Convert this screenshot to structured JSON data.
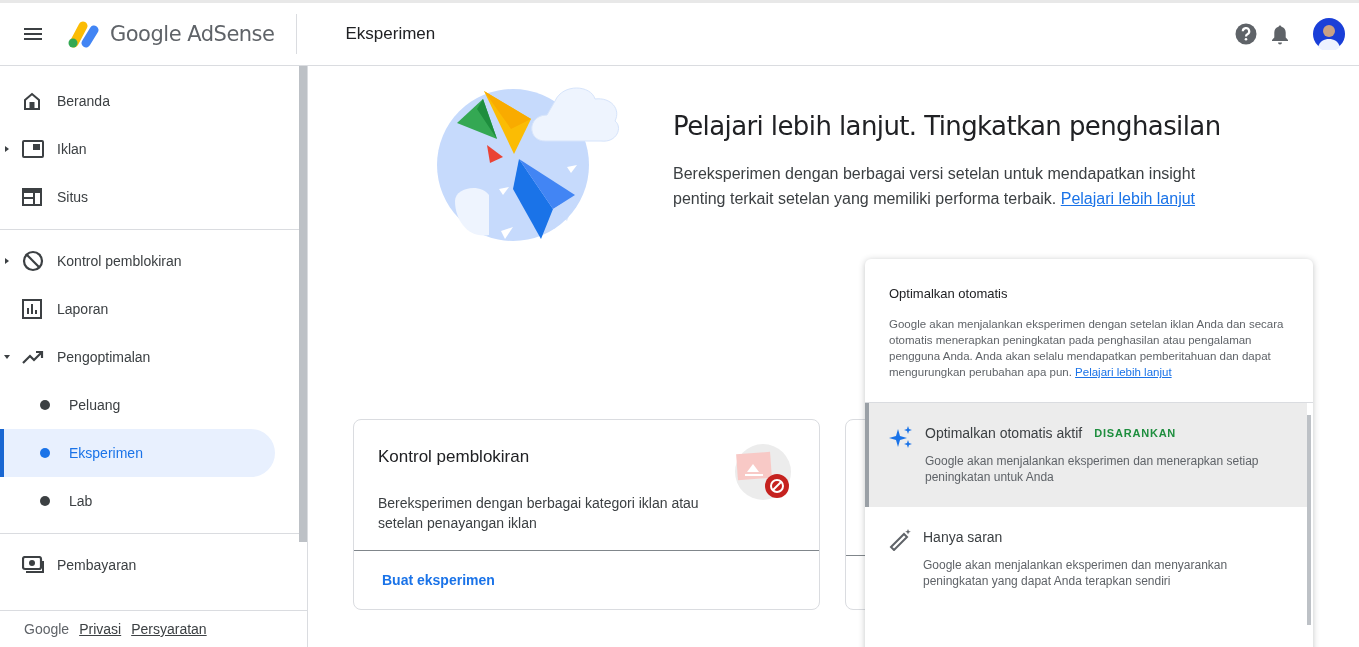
{
  "header": {
    "product": "Google AdSense",
    "page_title": "Eksperimen"
  },
  "sidebar": {
    "sections": [
      [
        {
          "label": "Beranda"
        },
        {
          "label": "Iklan",
          "expanded": false
        },
        {
          "label": "Situs"
        }
      ],
      [
        {
          "label": "Kontrol pemblokiran",
          "expanded": false
        },
        {
          "label": "Laporan"
        },
        {
          "label": "Pengoptimalan",
          "expanded": true,
          "children": [
            {
              "label": "Peluang",
              "selected": false
            },
            {
              "label": "Eksperimen",
              "selected": true
            },
            {
              "label": "Lab",
              "selected": false
            }
          ]
        }
      ],
      [
        {
          "label": "Pembayaran"
        }
      ]
    ],
    "footer": {
      "brand": "Google",
      "links": [
        "Privasi",
        "Persyaratan"
      ]
    }
  },
  "hero": {
    "title": "Pelajari lebih lanjut. Tingkatkan penghasilan",
    "text": "Bereksperimen dengan berbagai versi setelan untuk mendapatkan insight penting terkait setelan yang memiliki performa terbaik.",
    "link": "Pelajari lebih lanjut"
  },
  "cards": [
    {
      "title": "Kontrol pemblokiran",
      "text": "Bereksperimen dengan berbagai kategori iklan atau setelan penayangan iklan",
      "action": "Buat eksperimen"
    }
  ],
  "popup": {
    "title": "Optimalkan otomatis",
    "text": "Google akan menjalankan eksperimen dengan setelan iklan Anda dan secara otomatis menerapkan peningkatan pada penghasilan atau pengalaman pengguna Anda. Anda akan selalu mendapatkan pemberitahuan dan dapat mengurungkan perubahan apa pun.",
    "link": "Pelajari lebih lanjut",
    "options": [
      {
        "title": "Optimalkan otomatis aktif",
        "badge": "DISARANKAN",
        "text": "Google akan menjalankan eksperimen dan menerapkan setiap peningkatan untuk Anda",
        "selected": true
      },
      {
        "title": "Hanya saran",
        "text": "Google akan menjalankan eksperimen dan menyarankan peningkatan yang dapat Anda terapkan sendiri",
        "selected": false
      }
    ]
  }
}
